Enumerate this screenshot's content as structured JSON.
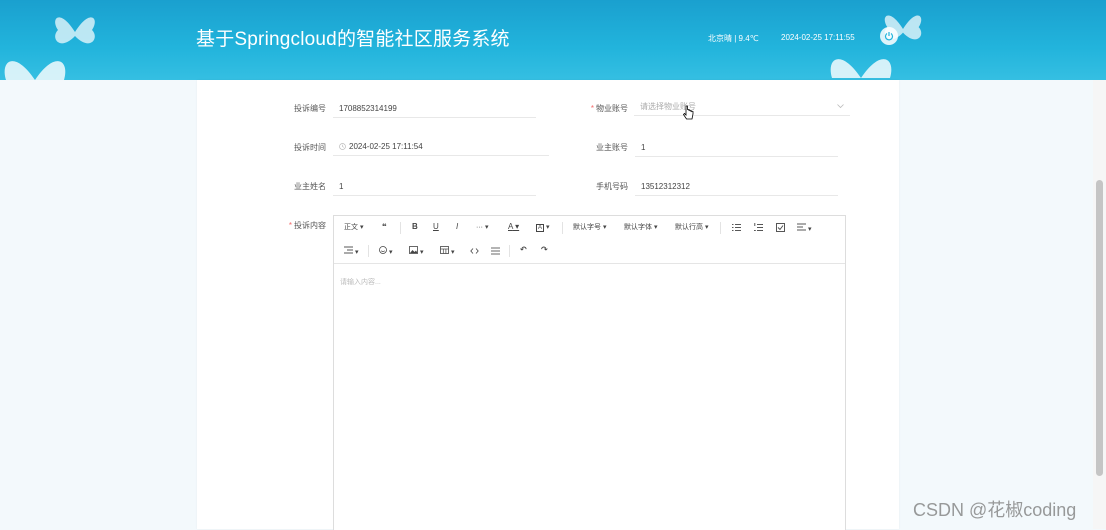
{
  "header": {
    "title": "基于Springcloud的智能社区服务系统",
    "weather": "北京晴 | 9.4℃",
    "datetime": "2024-02-25  17:11:55",
    "bg_color": "#22b4dc"
  },
  "form": {
    "complaint_no": {
      "label": "投诉编号",
      "value": "1708852314199"
    },
    "property_account": {
      "label": "物业账号",
      "placeholder": "请选择物业账号",
      "required": true
    },
    "complaint_time": {
      "label": "投诉时间",
      "value": "2024-02-25 17:11:54"
    },
    "owner_account": {
      "label": "业主账号",
      "value": "1"
    },
    "owner_name": {
      "label": "业主姓名",
      "value": "1"
    },
    "phone": {
      "label": "手机号码",
      "value": "13512312312"
    },
    "content": {
      "label": "投诉内容",
      "placeholder": "请输入内容...",
      "required": true
    }
  },
  "toolbar": {
    "paragraph": "正文",
    "quote": "❝",
    "bold": "B",
    "underline": "U",
    "italic": "I",
    "more": "···",
    "font_color": "A",
    "bg_color": "A",
    "font_size": "默认字号",
    "font_family": "默认字体",
    "line_height": "默认行高",
    "undo": "↶",
    "redo": "↷"
  },
  "watermark": "CSDN @花椒coding"
}
